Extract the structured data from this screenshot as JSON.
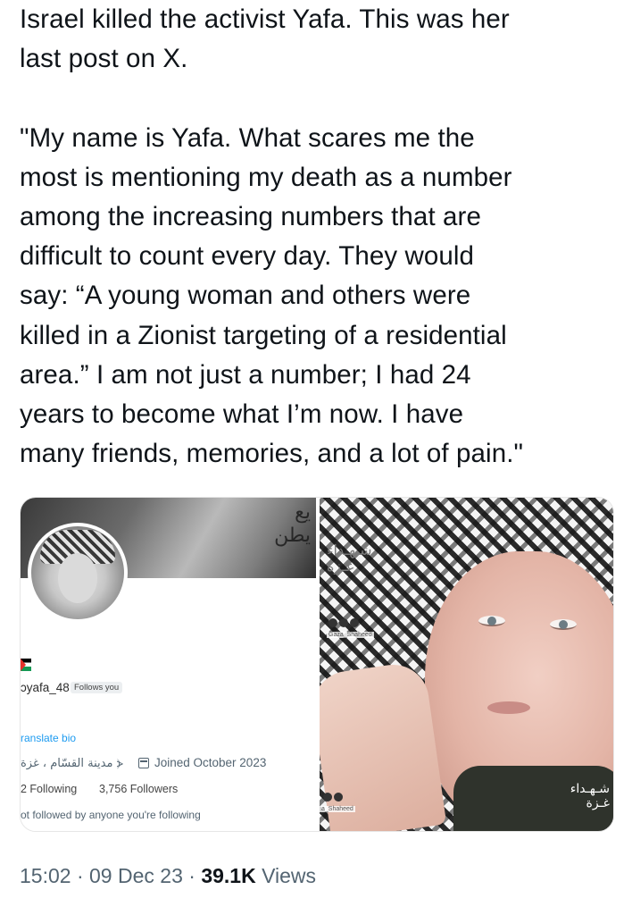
{
  "tweet": {
    "text": "Israel killed the activist Yafa. This was her\nlast post on X.\n\n\"My name is Yafa. What scares me the\nmost is mentioning my death as a number\namong the increasing numbers that are\ndifficult to count every day. They would\nsay: “A young woman and others were\nkilled in a Zionist targeting of a residential\narea.” I am not just a number; I had 24\nyears to become what I’m now. I have\nmany friends, memories, and a lot of pain.\""
  },
  "profile_screenshot": {
    "banner_text": "يع\nيطن",
    "handle": "ɔyafa_48",
    "follows_you": "Follows you",
    "translate_bio": "ranslate bio",
    "location": "مدينة القسّام ، غزة ⦔",
    "joined": "Joined October 2023",
    "following": "2 Following",
    "followers": "3,756 Followers",
    "not_followed": "ot followed by anyone you're following"
  },
  "photo": {
    "watermark_top": "شـهـداء\nغـزة",
    "watermark_handle_top": "Gaza_Shaheed",
    "watermark_handle_bottom": "a_Shaheed",
    "watermark_bottom": "شـهـداء\nغـزة"
  },
  "meta": {
    "time": "15:02",
    "sep1": " · ",
    "date": "09 Dec 23",
    "sep2": " · ",
    "views_count": "39.1K",
    "views_label": " Views"
  },
  "colors": {
    "text": "#0f1419",
    "secondary": "#536471",
    "link": "#1d9bf0"
  }
}
